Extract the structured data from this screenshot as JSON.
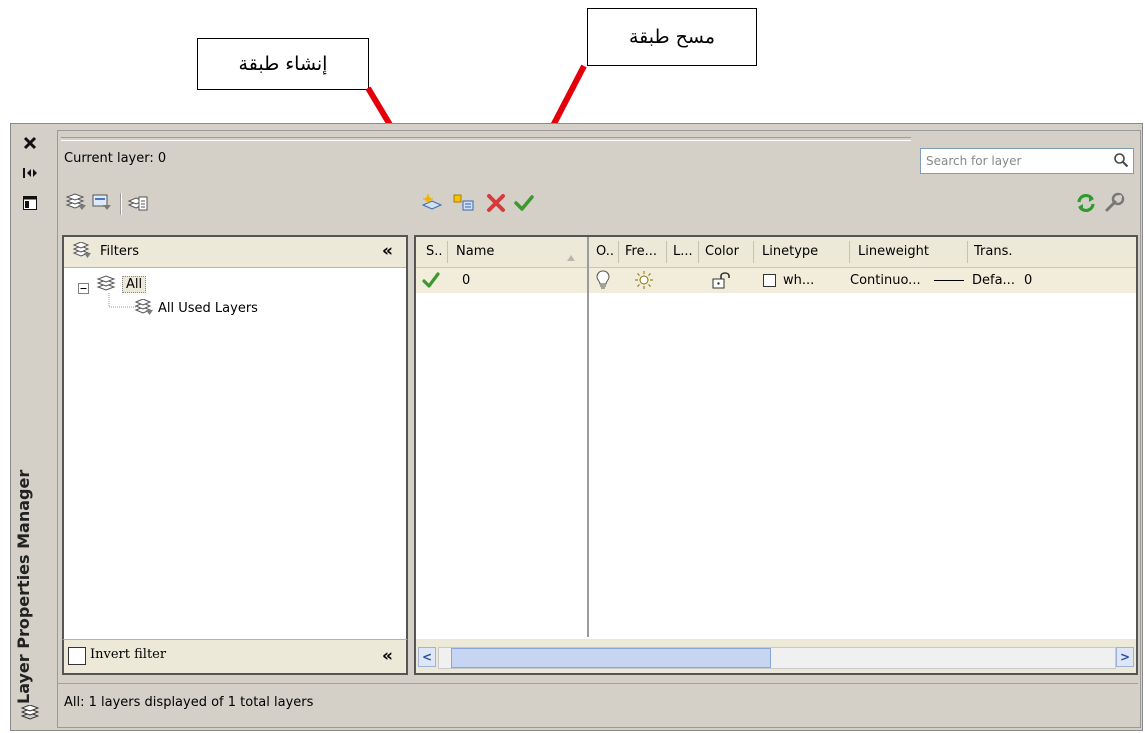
{
  "annotations": {
    "create_layer": "إنشاء طبقة",
    "delete_layer": "مسح طبقة"
  },
  "sidebar": {
    "title": "Layer Properties Manager",
    "icons": [
      "close-icon",
      "auto-hide-icon",
      "properties-icon",
      "layers-icon"
    ]
  },
  "header": {
    "current_layer": "Current layer: 0",
    "search_placeholder": "Search for layer"
  },
  "toolbar": {
    "left_icons": [
      "new-property-filter-icon",
      "new-group-filter-icon",
      "layer-states-manager-icon"
    ],
    "center_icons": [
      "new-layer-icon",
      "new-layer-vp-frozen-icon",
      "delete-layer-icon",
      "set-current-icon"
    ],
    "right_icons": [
      "refresh-icon",
      "settings-icon"
    ]
  },
  "filters": {
    "title": "Filters",
    "tree": [
      {
        "label": "All",
        "icon": "layers-icon"
      },
      {
        "label": "All Used Layers",
        "icon": "used-layers-filter-icon"
      }
    ],
    "invert_label": "Invert filter",
    "invert_checked": false
  },
  "grid": {
    "columns": [
      "S..",
      "Name",
      "O..",
      "Fre...",
      "L...",
      "Color",
      "Linetype",
      "Lineweight",
      "Trans."
    ],
    "rows": [
      {
        "status": "current-check-icon",
        "name": "0",
        "on": "lightbulb-icon",
        "freeze": "sun-icon",
        "lock": "unlock-icon",
        "color": "wh...",
        "color_hex": "#ffffff",
        "linetype": "Continuo...",
        "lineweight": "Defa...",
        "transparency": "0"
      }
    ]
  },
  "status_bar": "All: 1 layers displayed of 1 total layers",
  "colors": {
    "panel_bg": "#d4d0c8",
    "header_bg": "#ece9d8",
    "row_bg": "#f1edda",
    "arrow": "#e3000b",
    "check": "#3a9a2e",
    "delete": "#d63b3b"
  }
}
